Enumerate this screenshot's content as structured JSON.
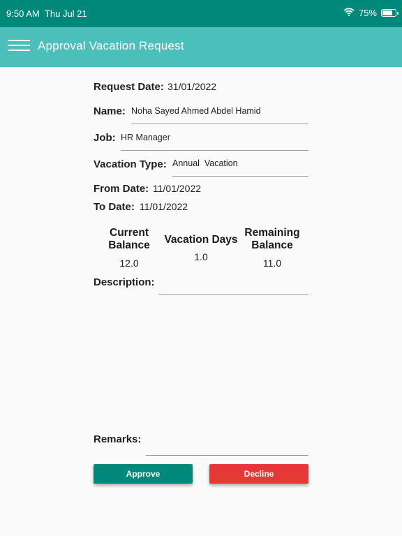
{
  "status_bar": {
    "time": "9:50 AM",
    "date": "Thu Jul 21",
    "battery_text": "75%",
    "battery_level": 0.75
  },
  "app_bar": {
    "title": "Approval Vacation Request"
  },
  "form": {
    "request_date_label": "Request Date:",
    "request_date_value": "31/01/2022",
    "name_label": "Name:",
    "name_value": "Noha Sayed Ahmed Abdel Hamid",
    "job_label": "Job:",
    "job_value": "HR Manager",
    "vacation_type_label": "Vacation Type:",
    "vacation_type_value": "Annual  Vacation",
    "from_date_label": "From Date:",
    "from_date_value": "11/01/2022",
    "to_date_label": "To Date:",
    "to_date_value": "11/01/2022",
    "current_balance_label_1": "Current",
    "current_balance_label_2": "Balance",
    "current_balance_value": "12.0",
    "vacation_days_label": "Vacation Days",
    "vacation_days_value": "1.0",
    "remaining_balance_label_1": "Remaining",
    "remaining_balance_label_2": "Balance",
    "remaining_balance_value": "11.0",
    "description_label": "Description:",
    "description_value": "",
    "remarks_label": "Remarks:",
    "remarks_value": ""
  },
  "actions": {
    "approve_label": "Approve",
    "decline_label": "Decline"
  },
  "colors": {
    "status_bar": "#00897b",
    "app_bar": "#4dbfba",
    "approve": "#00897b",
    "decline": "#e53935"
  }
}
